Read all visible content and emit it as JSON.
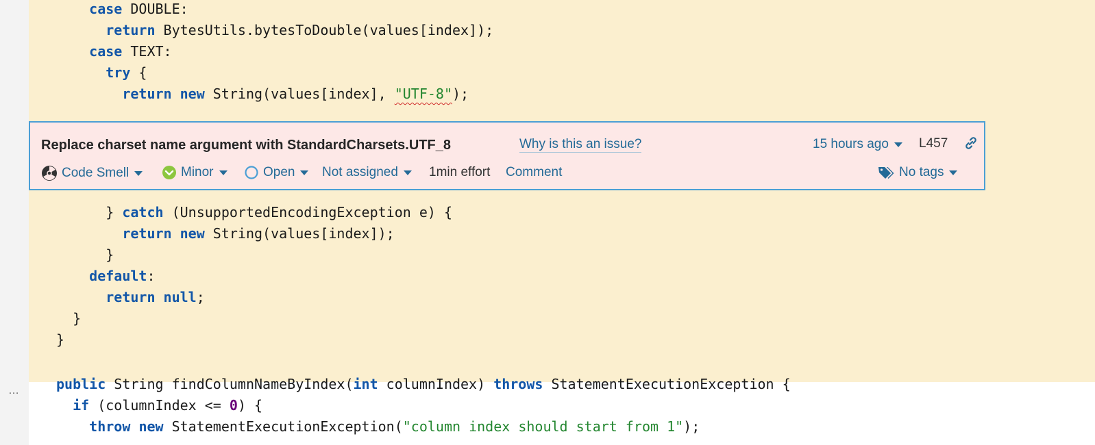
{
  "code_top": [
    {
      "indent": "    ",
      "parts": [
        {
          "t": "case",
          "c": "kw"
        },
        {
          "t": " DOUBLE:",
          "c": ""
        }
      ]
    },
    {
      "indent": "      ",
      "parts": [
        {
          "t": "return",
          "c": "kw"
        },
        {
          "t": " BytesUtils.bytesToDouble(values[index]);",
          "c": ""
        }
      ]
    },
    {
      "indent": "    ",
      "parts": [
        {
          "t": "case",
          "c": "kw"
        },
        {
          "t": " TEXT:",
          "c": ""
        }
      ]
    },
    {
      "indent": "      ",
      "parts": [
        {
          "t": "try",
          "c": "kw"
        },
        {
          "t": " {",
          "c": ""
        }
      ]
    },
    {
      "indent": "        ",
      "parts": [
        {
          "t": "return",
          "c": "kw"
        },
        {
          "t": " ",
          "c": ""
        },
        {
          "t": "new",
          "c": "kw"
        },
        {
          "t": " String(values[index], ",
          "c": ""
        },
        {
          "t": "\"UTF-8\"",
          "c": "str squig"
        },
        {
          "t": ");",
          "c": ""
        }
      ]
    }
  ],
  "code_bottom": [
    {
      "indent": "      ",
      "parts": [
        {
          "t": "} ",
          "c": ""
        },
        {
          "t": "catch",
          "c": "kw"
        },
        {
          "t": " (UnsupportedEncodingException e) {",
          "c": ""
        }
      ]
    },
    {
      "indent": "        ",
      "parts": [
        {
          "t": "return",
          "c": "kw"
        },
        {
          "t": " ",
          "c": ""
        },
        {
          "t": "new",
          "c": "kw"
        },
        {
          "t": " String(values[index]);",
          "c": ""
        }
      ]
    },
    {
      "indent": "      ",
      "parts": [
        {
          "t": "}",
          "c": ""
        }
      ]
    },
    {
      "indent": "    ",
      "parts": [
        {
          "t": "default",
          "c": "kw"
        },
        {
          "t": ":",
          "c": ""
        }
      ]
    },
    {
      "indent": "      ",
      "parts": [
        {
          "t": "return",
          "c": "kw"
        },
        {
          "t": " ",
          "c": ""
        },
        {
          "t": "null",
          "c": "kw"
        },
        {
          "t": ";",
          "c": ""
        }
      ]
    },
    {
      "indent": "  ",
      "parts": [
        {
          "t": "}",
          "c": ""
        }
      ]
    },
    {
      "indent": "",
      "parts": [
        {
          "t": "}",
          "c": ""
        }
      ]
    }
  ],
  "code_after": [
    {
      "indent": "",
      "parts": [
        {
          "t": "public",
          "c": "kw"
        },
        {
          "t": " String findColumnNameByIndex(",
          "c": ""
        },
        {
          "t": "int",
          "c": "kw"
        },
        {
          "t": " columnIndex) ",
          "c": ""
        },
        {
          "t": "throws",
          "c": "kw"
        },
        {
          "t": " StatementExecutionException {",
          "c": ""
        }
      ]
    },
    {
      "indent": "  ",
      "parts": [
        {
          "t": "if",
          "c": "kw"
        },
        {
          "t": " (columnIndex <= ",
          "c": ""
        },
        {
          "t": "0",
          "c": "num"
        },
        {
          "t": ") {",
          "c": ""
        }
      ]
    },
    {
      "indent": "    ",
      "parts": [
        {
          "t": "throw",
          "c": "kw"
        },
        {
          "t": " ",
          "c": ""
        },
        {
          "t": "new",
          "c": "kw"
        },
        {
          "t": " StatementExecutionException(",
          "c": ""
        },
        {
          "t": "\"column index should start from 1\"",
          "c": "str"
        },
        {
          "t": ");",
          "c": ""
        }
      ]
    }
  ],
  "gutter": {
    "dots": "…"
  },
  "issue": {
    "title": "Replace charset name argument with StandardCharsets.UTF_8",
    "why_link": "Why is this an issue?",
    "age": "15 hours ago",
    "line": "L457",
    "type": "Code Smell",
    "severity": "Minor",
    "status": "Open",
    "assignee": "Not assigned",
    "effort": "1min effort",
    "comment": "Comment",
    "tags": "No tags"
  }
}
